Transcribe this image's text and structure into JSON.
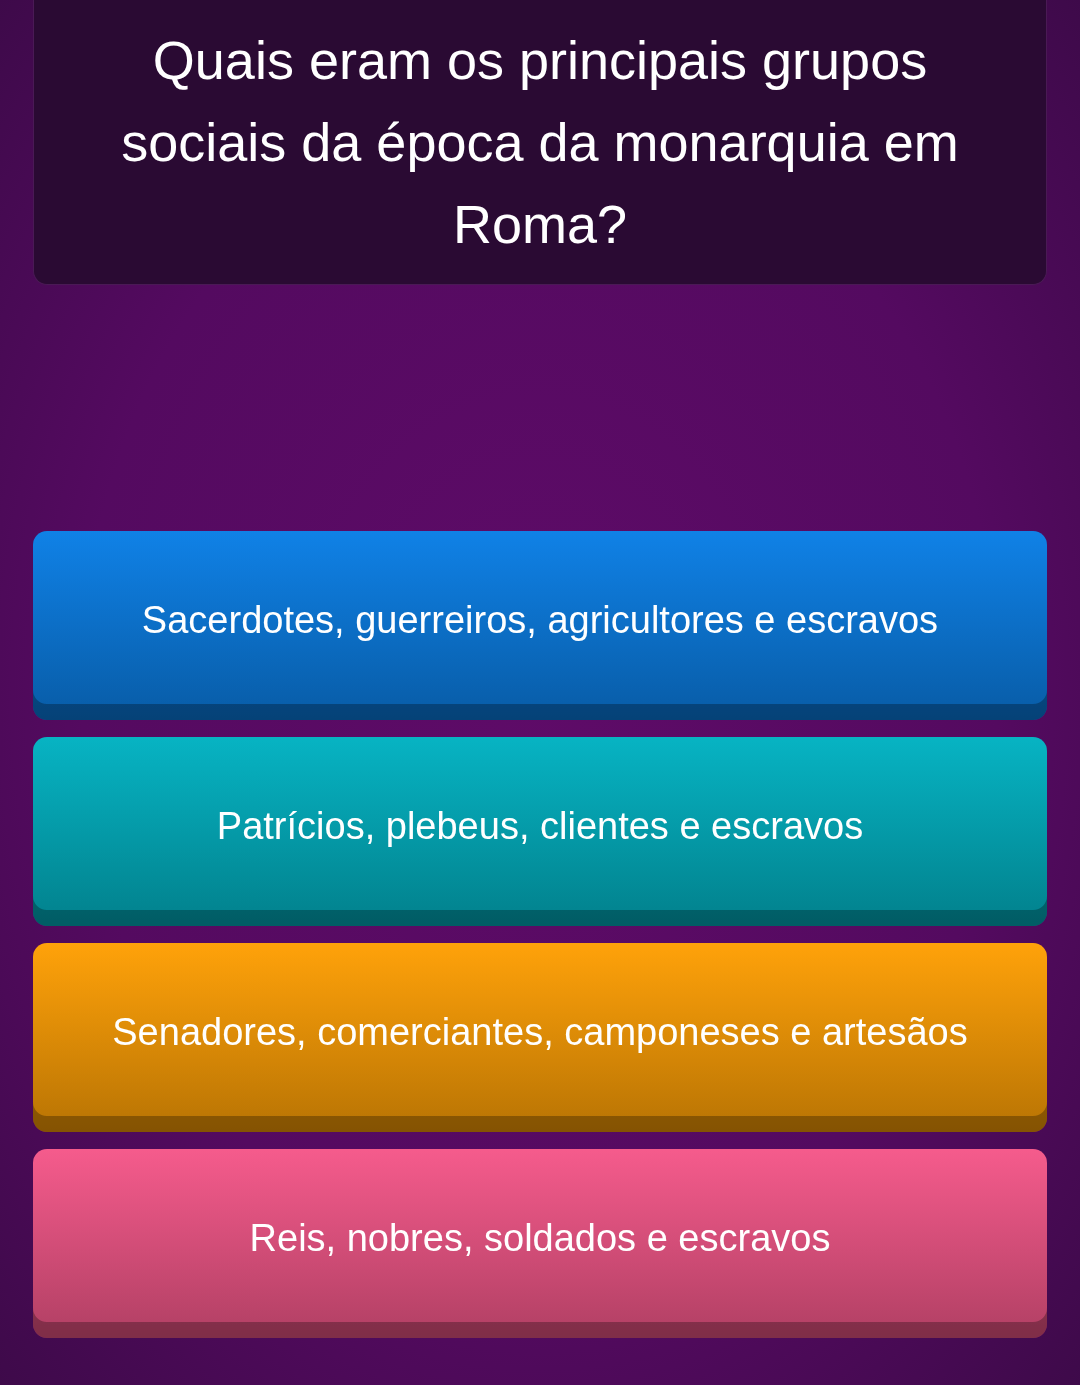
{
  "question": {
    "text": "Quais eram os principais grupos sociais da época da monarquia em Roma?"
  },
  "answers": [
    {
      "text": "Sacerdotes, guerreiros, agricultores e escravos",
      "color": "#0b7fe6"
    },
    {
      "text": "Patrícios, plebeus, clientes e escravos",
      "color": "#02b2c2"
    },
    {
      "text": "Senadores, comerciantes, camponeses e artesãos",
      "color": "#ffa005"
    },
    {
      "text": "Reis, nobres, soldados e escravos",
      "color": "#f5588a"
    }
  ]
}
